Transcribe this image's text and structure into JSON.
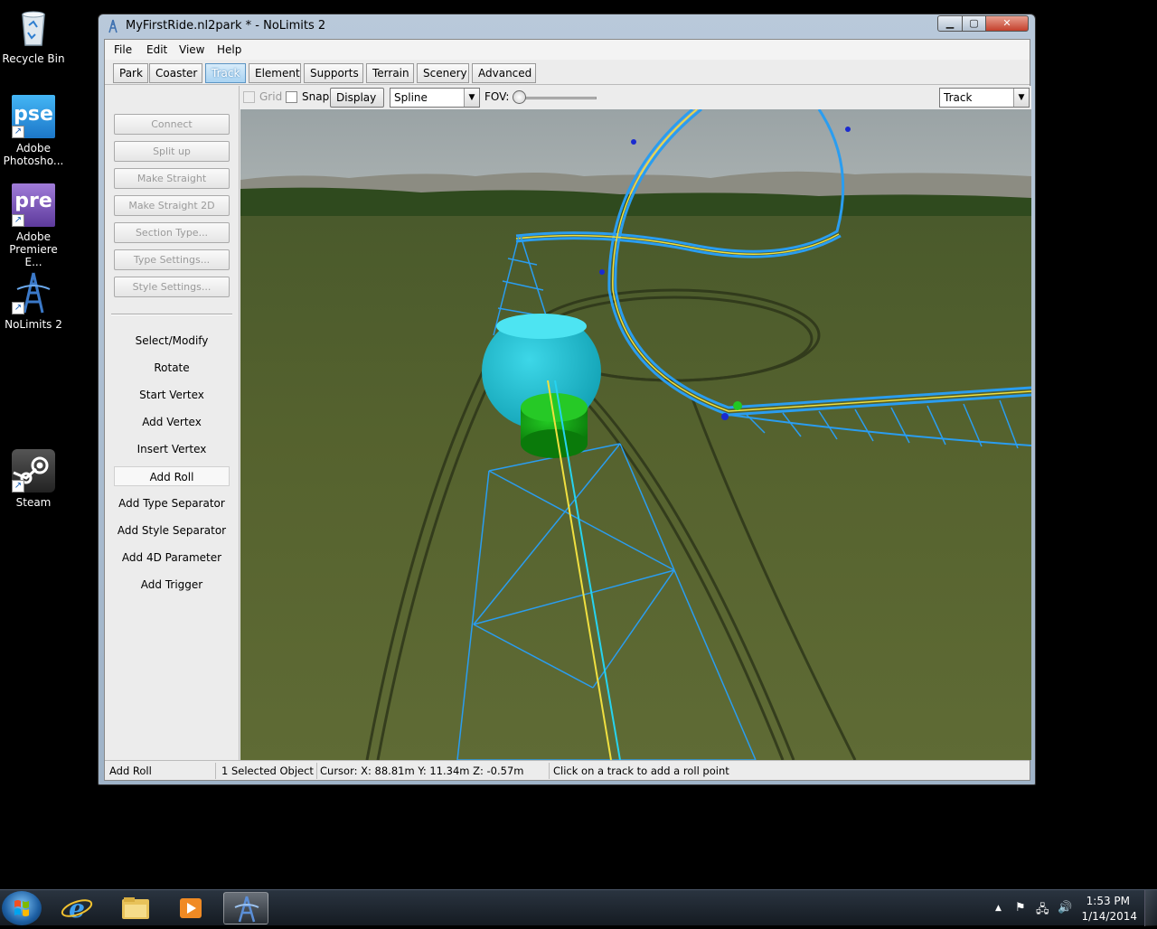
{
  "desktop": {
    "icons": [
      {
        "label": "Recycle Bin"
      },
      {
        "label": "Adobe Photosho...",
        "badge": "pse"
      },
      {
        "label": "Adobe Premiere E...",
        "badge": "pre"
      },
      {
        "label": "NoLimits 2"
      },
      {
        "label": "Steam"
      }
    ]
  },
  "window": {
    "title": "MyFirstRide.nl2park * - NoLimits 2",
    "minimize": "▁",
    "maximize": "▢",
    "close": "✕"
  },
  "menu": [
    "File",
    "Edit",
    "View",
    "Help"
  ],
  "tabs": [
    "Park",
    "Coaster",
    "Track",
    "Element",
    "Supports",
    "Terrain",
    "Scenery",
    "Advanced"
  ],
  "active_tab": "Track",
  "sidebar": {
    "buttons": [
      "Connect",
      "Split up",
      "Make Straight",
      "Make Straight 2D",
      "Section Type...",
      "Type Settings...",
      "Style Settings..."
    ],
    "tools": [
      "Select/Modify",
      "Rotate",
      "Start Vertex",
      "Add Vertex",
      "Insert Vertex",
      "Add Roll",
      "Add Type Separator",
      "Add Style Separator",
      "Add 4D Parameter",
      "Add Trigger"
    ],
    "selected_tool": "Add Roll"
  },
  "toolbar": {
    "grid_label": "Grid",
    "snap_label": "Snap",
    "display_label": "Display",
    "spline_value": "Spline",
    "fov_label": "FOV:",
    "fov_value": 0.05,
    "view_value": "Track",
    "dropdown_arrow": "▼"
  },
  "status": {
    "mode": "Add Roll",
    "selection": "1 Selected Object",
    "cursor": "Cursor:  X: 88.81m Y: 11.34m Z:  -0.57m",
    "hint": "Click on a track to add a roll point"
  },
  "taskbar": {
    "time": "1:53 PM",
    "date": "1/14/2014",
    "tray_arrow": "▲",
    "tray_flag": "⚑",
    "tray_network": "🖧",
    "tray_volume": "🔊"
  },
  "colors": {
    "track_blue": "#2a9df0",
    "track_cyan": "#26d3f0",
    "rail_yellow": "#f0e040",
    "support_cyan": "#18b5c8",
    "support_green": "#14a014",
    "tab_active": "#a9d3f2"
  }
}
